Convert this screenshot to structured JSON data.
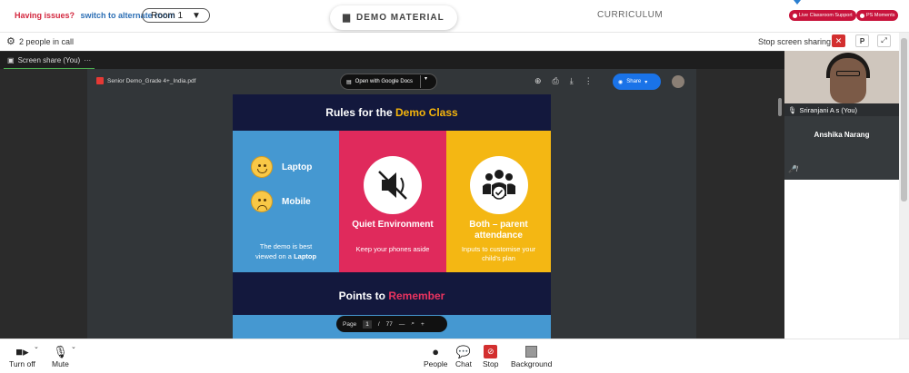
{
  "header": {
    "issue_text": "Having issues?",
    "alt_room_link": "switch to alternate room",
    "room_selector": "Room 1",
    "demo_material": "DEMO MATERIAL",
    "curriculum": "CURRICULUM",
    "live_support": "Live Classroom Support",
    "ps_moments": "PS Moments"
  },
  "call": {
    "people_count": "2 people in call",
    "stop_sharing": "Stop screen sharing",
    "p_label": "P"
  },
  "share_tab": {
    "label": "Screen share (You)",
    "more": "···"
  },
  "pdf": {
    "filename": "Senior Demo_Grade 4+_India.pdf",
    "open_with": "Open with Google Docs",
    "share": "Share",
    "page_label": "Page",
    "page_current": "1",
    "page_sep": "/",
    "page_total": "77"
  },
  "slide": {
    "rules_prefix": "Rules for the",
    "rules_highlight": "Demo Class",
    "laptop": "Laptop",
    "mobile": "Mobile",
    "blue_note_line1": "The demo is best",
    "blue_note_line2": "viewed on a",
    "blue_note_bold": "Laptop",
    "quiet_head": "Quiet Environment",
    "quiet_sub": "Keep your phones aside",
    "parent_head": "Both – parent attendance",
    "parent_sub": "Inputs to customise your child's plan",
    "points_prefix": "Points to",
    "points_highlight": "Remember"
  },
  "participants": {
    "self_name": "Sriranjani A s (You)",
    "other_name": "Anshika Narang"
  },
  "bottom": {
    "turn_off": "Turn off",
    "mute": "Mute",
    "people": "People",
    "chat": "Chat",
    "stop": "Stop",
    "background": "Background"
  },
  "colors": {
    "accent_red": "#d32f2f",
    "slide_navy": "#13183d",
    "slide_blue": "#4598d1",
    "slide_pink": "#e02a5c",
    "slide_gold": "#f4b713",
    "share_blue": "#1a73e8"
  }
}
